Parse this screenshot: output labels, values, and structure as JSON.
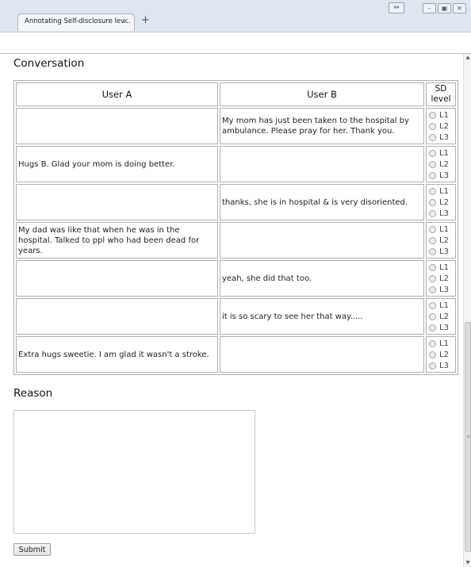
{
  "browser": {
    "tab_title": "Annotating Self-disclosure lev...",
    "tab_close": "×",
    "new_tab": "+"
  },
  "conversation": {
    "heading": "Conversation",
    "headers": {
      "user_a": "User A",
      "user_b": "User B",
      "sd": "SD level"
    },
    "levels": [
      "L1",
      "L2",
      "L3"
    ],
    "rows": [
      {
        "a": "",
        "b": "My mom has just been taken to the hospital by ambulance. Please pray for her. Thank you."
      },
      {
        "a": "Hugs B. Glad your mom is doing better.",
        "b": ""
      },
      {
        "a": "",
        "b": "thanks, she is in hospital & is very disoriented."
      },
      {
        "a": "My dad was like that when he was in the hospital. Talked to ppl who had been dead for years.",
        "b": ""
      },
      {
        "a": "",
        "b": "yeah, she did that too."
      },
      {
        "a": "",
        "b": "it is so scary to see her that way....."
      },
      {
        "a": "Extra hugs sweetie. I am glad it wasn't a stroke.",
        "b": ""
      }
    ]
  },
  "reason": {
    "heading": "Reason",
    "value": ""
  },
  "submit_label": "Submit"
}
